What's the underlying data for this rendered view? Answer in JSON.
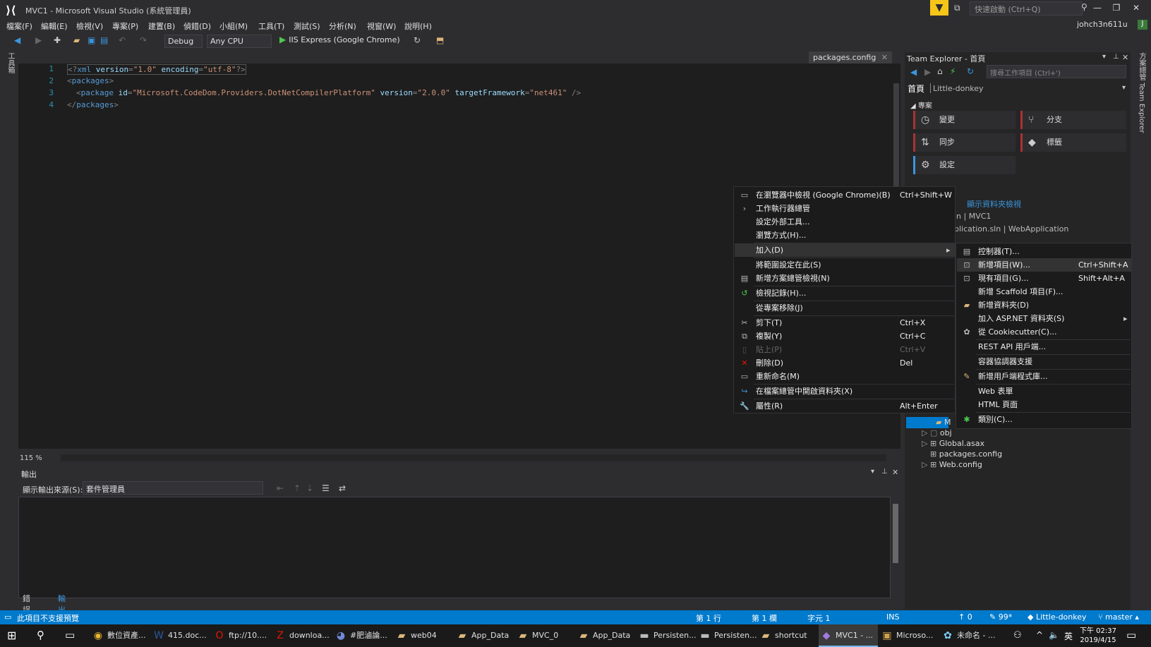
{
  "window": {
    "title": "MVC1 - Microsoft Visual Studio (系統管理員)",
    "quick_launch_placeholder": "快速啟動 (Ctrl+Q)",
    "user": "johch3n611u",
    "avatar_letter": "J"
  },
  "menu": [
    "檔案(F)",
    "編輯(E)",
    "檢視(V)",
    "專案(P)",
    "建置(B)",
    "偵錯(D)",
    "小組(M)",
    "工具(T)",
    "測試(S)",
    "分析(N)",
    "視窗(W)",
    "說明(H)"
  ],
  "toolbar": {
    "config": "Debug",
    "platform": "Any CPU",
    "run_label": "IIS Express (Google Chrome)"
  },
  "left_strip_label": "工具箱",
  "editor": {
    "tab": "packages.config",
    "line_numbers": [
      "1",
      "2",
      "3",
      "4"
    ],
    "zoom": "115 %",
    "line1": {
      "open": "<?",
      "tag": "xml",
      "a1": "version",
      "v1": "\"1.0\"",
      "a2": "encoding",
      "v2": "\"utf-8\"",
      "close": "?>"
    },
    "line2": {
      "tag": "packages"
    },
    "line3": {
      "tag": "package",
      "a1": "id",
      "v1": "\"Microsoft.CodeDom.Providers.DotNetCompilerPlatform\"",
      "a2": "version",
      "v2": "\"2.0.0\"",
      "a3": "targetFramework",
      "v3": "\"net461\"",
      "close": "/>"
    },
    "line4": {
      "tag": "packages"
    }
  },
  "output": {
    "title": "輸出",
    "source_label": "顯示輸出來源(S):",
    "source_value": "套件管理員",
    "tabs": [
      "錯誤清單",
      "輸出"
    ]
  },
  "team_explorer": {
    "title": "Team Explorer - 首頁",
    "search_placeholder": "搜尋工作項目 (Ctrl+')",
    "home": "首頁",
    "repo": "Little-donkey",
    "project_header": "專案",
    "tiles": [
      "變更",
      "分支",
      "同步",
      "標籤",
      "設定"
    ],
    "solutions_link": "顯示資料夾檢視",
    "solution_line1": "ln | MVC1",
    "solution_line2": "plication.sln | WebApplication",
    "tree": [
      "M",
      "obj",
      "Global.asax",
      "packages.config",
      "Web.config"
    ]
  },
  "right_strip_label": "方案總管 Team Explorer",
  "context_menu": [
    {
      "label": "在瀏覽器中檢視 (Google Chrome)(B)",
      "shortcut": "Ctrl+Shift+W",
      "icon": "browser-icon"
    },
    {
      "label": "工作執行器總管",
      "shortcut": "",
      "icon": "chevron-right-icon"
    },
    {
      "label": "設定外部工具...",
      "shortcut": "",
      "icon": ""
    },
    {
      "label": "瀏覽方式(H)...",
      "shortcut": "",
      "icon": ""
    },
    {
      "label": "加入(D)",
      "shortcut": "",
      "icon": ""
    },
    {
      "label": "將範圍設定在此(S)",
      "shortcut": "",
      "icon": ""
    },
    {
      "label": "新增方案總管檢視(N)",
      "shortcut": "",
      "icon": "window-icon"
    },
    {
      "label": "檢視記錄(H)...",
      "shortcut": "",
      "icon": "history-icon"
    },
    {
      "label": "從專案移除(J)",
      "shortcut": "",
      "icon": ""
    },
    {
      "label": "剪下(T)",
      "shortcut": "Ctrl+X",
      "icon": "scissors-icon"
    },
    {
      "label": "複製(Y)",
      "shortcut": "Ctrl+C",
      "icon": "copy-icon"
    },
    {
      "label": "貼上(P)",
      "shortcut": "Ctrl+V",
      "icon": "paste-icon"
    },
    {
      "label": "刪除(D)",
      "shortcut": "Del",
      "icon": "delete-icon"
    },
    {
      "label": "重新命名(M)",
      "shortcut": "",
      "icon": "rename-icon"
    },
    {
      "label": "在檔案總管中開啟資料夾(X)",
      "shortcut": "",
      "icon": "refresh-folder-icon"
    },
    {
      "label": "屬性(R)",
      "shortcut": "Alt+Enter",
      "icon": "wrench-icon"
    }
  ],
  "submenu": [
    {
      "label": "控制器(T)...",
      "shortcut": "",
      "icon": "file-icon"
    },
    {
      "label": "新增項目(W)...",
      "shortcut": "Ctrl+Shift+A",
      "icon": "new-item-icon"
    },
    {
      "label": "現有項目(G)...",
      "shortcut": "Shift+Alt+A",
      "icon": "existing-item-icon"
    },
    {
      "label": "新增 Scaffold 項目(F)...",
      "shortcut": "",
      "icon": ""
    },
    {
      "label": "新增資料夾(D)",
      "shortcut": "",
      "icon": "folder-icon"
    },
    {
      "label": "加入 ASP.NET 資料夾(S)",
      "shortcut": "",
      "icon": ""
    },
    {
      "label": "從 Cookiecutter(C)...",
      "shortcut": "",
      "icon": "cookiecutter-icon"
    },
    {
      "label": "REST API 用戶端...",
      "shortcut": "",
      "icon": ""
    },
    {
      "label": "容器協調器支援",
      "shortcut": "",
      "icon": ""
    },
    {
      "label": "新增用戶端程式庫...",
      "shortcut": "",
      "icon": "library-icon"
    },
    {
      "label": "Web 表單",
      "shortcut": "",
      "icon": ""
    },
    {
      "label": "HTML 頁面",
      "shortcut": "",
      "icon": ""
    },
    {
      "label": "類別(C)...",
      "shortcut": "",
      "icon": "class-icon"
    }
  ],
  "statusbar": {
    "message": "此項目不支援預覽",
    "line": "第 1 行",
    "col": "第 1 欄",
    "char": "字元 1",
    "ins": "INS",
    "up": "0",
    "pencil": "99*",
    "repo": "Little-donkey",
    "branch": "master"
  },
  "taskbar": [
    {
      "label": "數位資產...",
      "icon": "chrome-icon"
    },
    {
      "label": "415.doc...",
      "icon": "word-icon"
    },
    {
      "label": "ftp://10....",
      "icon": "opera-icon"
    },
    {
      "label": "downloa...",
      "icon": "filezilla-icon"
    },
    {
      "label": "#肥滷論...",
      "icon": "discord-icon"
    },
    {
      "label": "web04",
      "icon": "folder-icon"
    },
    {
      "label": "App_Data",
      "icon": "folder-icon"
    },
    {
      "label": "MVC_0",
      "icon": "folder-icon"
    },
    {
      "label": "App_Data",
      "icon": "folder-icon"
    },
    {
      "label": "Persisten...",
      "icon": "drive-icon"
    },
    {
      "label": "Persisten...",
      "icon": "drive-icon"
    },
    {
      "label": "shortcut",
      "icon": "folder-icon"
    },
    {
      "label": "MVC1 - ...",
      "icon": "vs-icon"
    },
    {
      "label": "Microso...",
      "icon": "sqlserver-icon"
    },
    {
      "label": "未命名 - ...",
      "icon": "paint-icon"
    }
  ],
  "tray": {
    "ime": "英",
    "time": "下午 02:37",
    "date": "2019/4/15"
  }
}
